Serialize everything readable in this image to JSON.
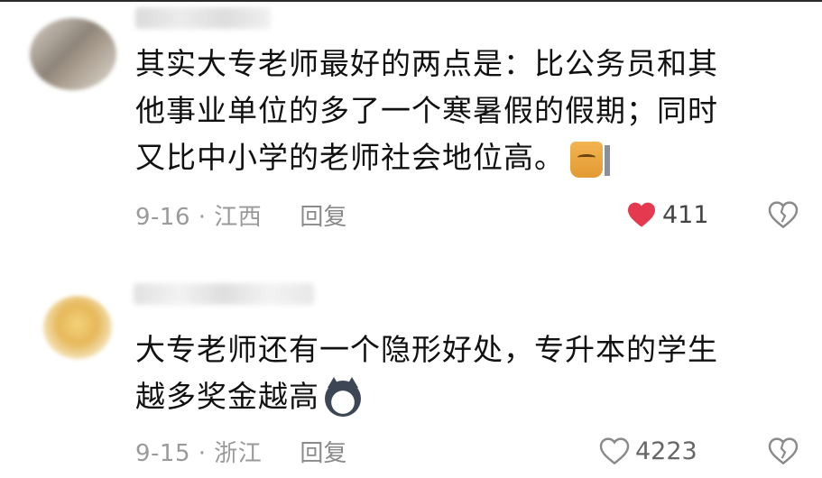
{
  "comments": [
    {
      "text_lines": [
        "其实大专老师最好的两点是：比公务员和其",
        "他事业单位的多了一个寒暑假的假期；同时",
        "又比中小学的老师社会地位高。"
      ],
      "emoji": "doge-emoji",
      "date": "9-16",
      "location": "江西",
      "date_location": "9-16 · 江西",
      "reply_label": "回复",
      "like_count": "411",
      "liked": true,
      "like_color": "#e5394f"
    },
    {
      "text_lines": [
        "大专老师还有一个隐形好处，专升本的学生",
        "越多奖金越高"
      ],
      "emoji": "husky-emoji",
      "date": "9-15",
      "location": "浙江",
      "date_location": "9-15 · 浙江",
      "reply_label": "回复",
      "like_count": "4223",
      "liked": false,
      "like_color": "#8a8a8a"
    }
  ]
}
